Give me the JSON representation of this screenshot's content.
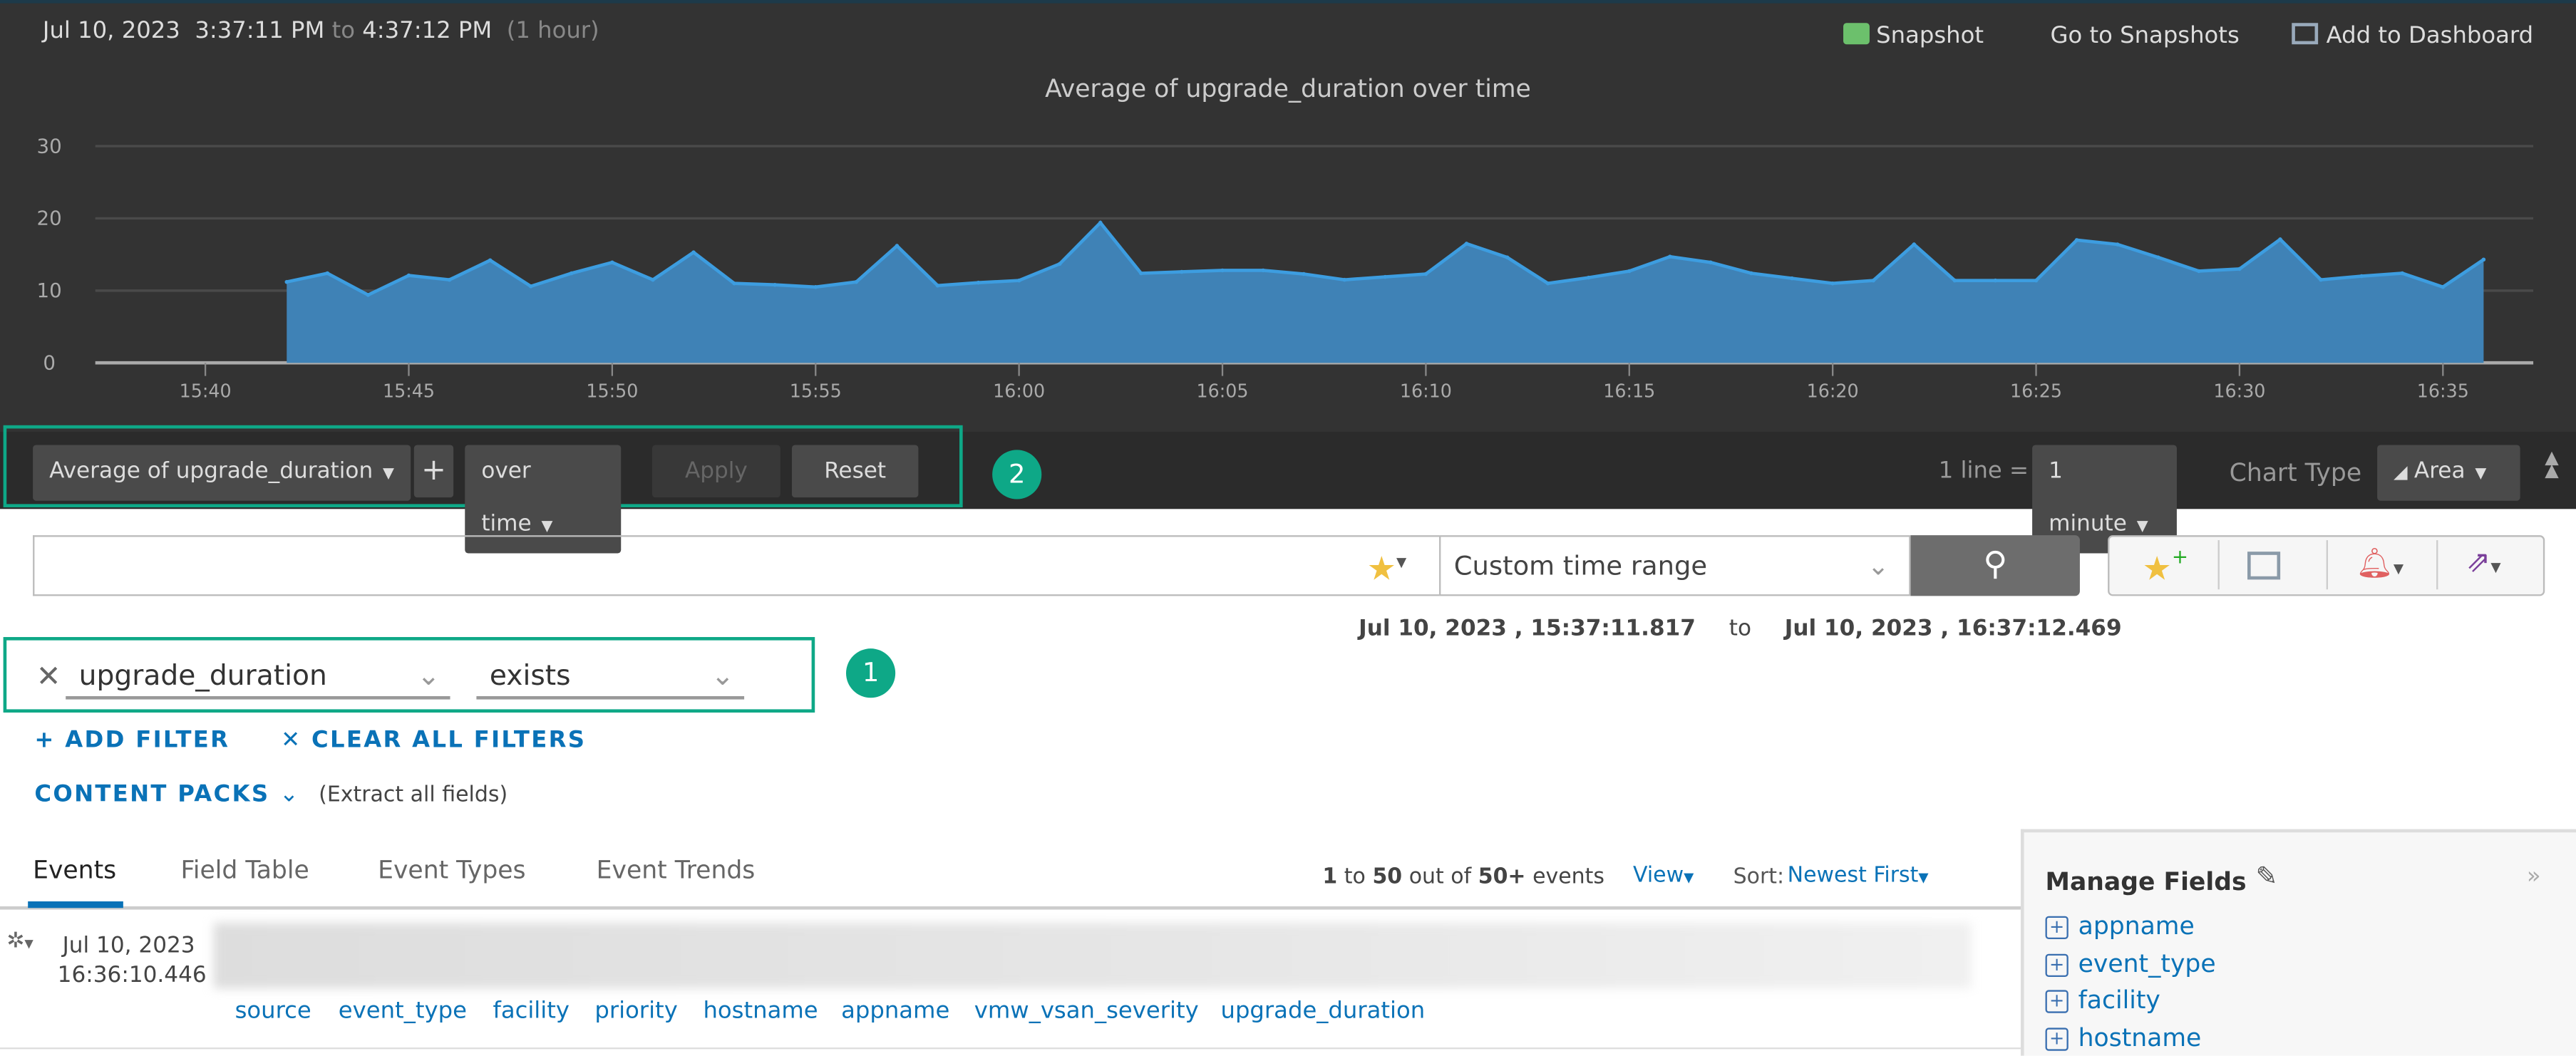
{
  "header": {
    "date": "Jul 10, 2023",
    "start_time": "3:37:11 PM",
    "to": "to",
    "end_time": "4:37:12 PM",
    "duration": "(1 hour)",
    "actions": {
      "snapshot": "Snapshot",
      "go_to_snapshots": "Go to Snapshots",
      "add_to_dashboard": "Add to Dashboard"
    }
  },
  "chart_data": {
    "type": "area",
    "title": "Average of upgrade_duration over time",
    "xlabel": "",
    "ylabel": "",
    "ylim": [
      0,
      30
    ],
    "yticks": [
      0,
      10,
      20,
      30
    ],
    "xticks": [
      "15:40",
      "15:45",
      "15:50",
      "15:55",
      "16:00",
      "16:05",
      "16:10",
      "16:15",
      "16:20",
      "16:25",
      "16:30",
      "16:35"
    ],
    "grid": true,
    "color": "#3f82b6",
    "line_color": "#3d9de0",
    "x": [
      "15:42",
      "15:43",
      "15:44",
      "15:45",
      "15:46",
      "15:47",
      "15:48",
      "15:49",
      "15:50",
      "15:51",
      "15:52",
      "15:53",
      "15:54",
      "15:55",
      "15:56",
      "15:57",
      "15:58",
      "15:59",
      "16:00",
      "16:01",
      "16:02",
      "16:03",
      "16:04",
      "16:05",
      "16:06",
      "16:07",
      "16:08",
      "16:09",
      "16:10",
      "16:11",
      "16:12",
      "16:13",
      "16:14",
      "16:15",
      "16:16",
      "16:17",
      "16:18",
      "16:19",
      "16:20",
      "16:21",
      "16:22",
      "16:23",
      "16:24",
      "16:25",
      "16:26",
      "16:27",
      "16:28",
      "16:29",
      "16:30",
      "16:31",
      "16:32",
      "16:33",
      "16:34",
      "16:35",
      "16:36"
    ],
    "values": [
      11.2,
      12.4,
      9.4,
      12.1,
      11.5,
      14.2,
      10.6,
      12.4,
      13.9,
      11.5,
      15.3,
      11.0,
      10.8,
      10.5,
      11.2,
      16.2,
      10.7,
      11.1,
      11.4,
      13.7,
      19.4,
      12.4,
      12.6,
      12.8,
      12.8,
      12.3,
      11.5,
      11.9,
      12.3,
      16.5,
      14.6,
      11.0,
      11.8,
      12.7,
      14.7,
      13.9,
      12.4,
      11.7,
      11.0,
      11.4,
      16.4,
      11.4,
      11.4,
      11.4,
      17.0,
      16.4,
      14.6,
      12.7,
      13.0,
      17.1,
      11.5,
      12.0,
      12.4,
      10.5,
      14.3
    ]
  },
  "toolbar": {
    "aggregate": "Average of upgrade_duration",
    "plus": "+",
    "group": "over time",
    "apply": "Apply",
    "reset": "Reset",
    "badge": "2",
    "line_label": "1 line =",
    "interval": "1 minute",
    "chart_type_label": "Chart Type",
    "chart_type": "Area"
  },
  "search": {
    "query": "",
    "time_range": "Custom time range",
    "range_start": "Jul 10, 2023 , 15:37:11.817",
    "range_to": "to",
    "range_end": "Jul 10, 2023 , 16:37:12.469"
  },
  "filter": {
    "field": "upgrade_duration",
    "operator": "exists",
    "badge": "1",
    "add_filter": "+ ADD FILTER",
    "clear_all": "✕ CLEAR ALL FILTERS",
    "content_packs": "CONTENT PACKS",
    "extract": "(Extract all fields)"
  },
  "tabs": [
    "Events",
    "Field Table",
    "Event Types",
    "Event Trends"
  ],
  "results": {
    "from": "1",
    "to_word": "to",
    "to": "50",
    "out_of": "out of",
    "total": "50+",
    "unit": "events",
    "view": "View",
    "sort_label": "Sort:",
    "sort": "Newest First"
  },
  "events": [
    {
      "date": "Jul 10, 2023",
      "time": "16:36:10.446",
      "fields": [
        "source",
        "event_type",
        "facility",
        "priority",
        "hostname",
        "appname",
        "vmw_vsan_severity",
        "upgrade_duration"
      ]
    }
  ],
  "manage_fields": {
    "title": "Manage Fields",
    "items": [
      "appname",
      "event_type",
      "facility",
      "hostname"
    ]
  }
}
